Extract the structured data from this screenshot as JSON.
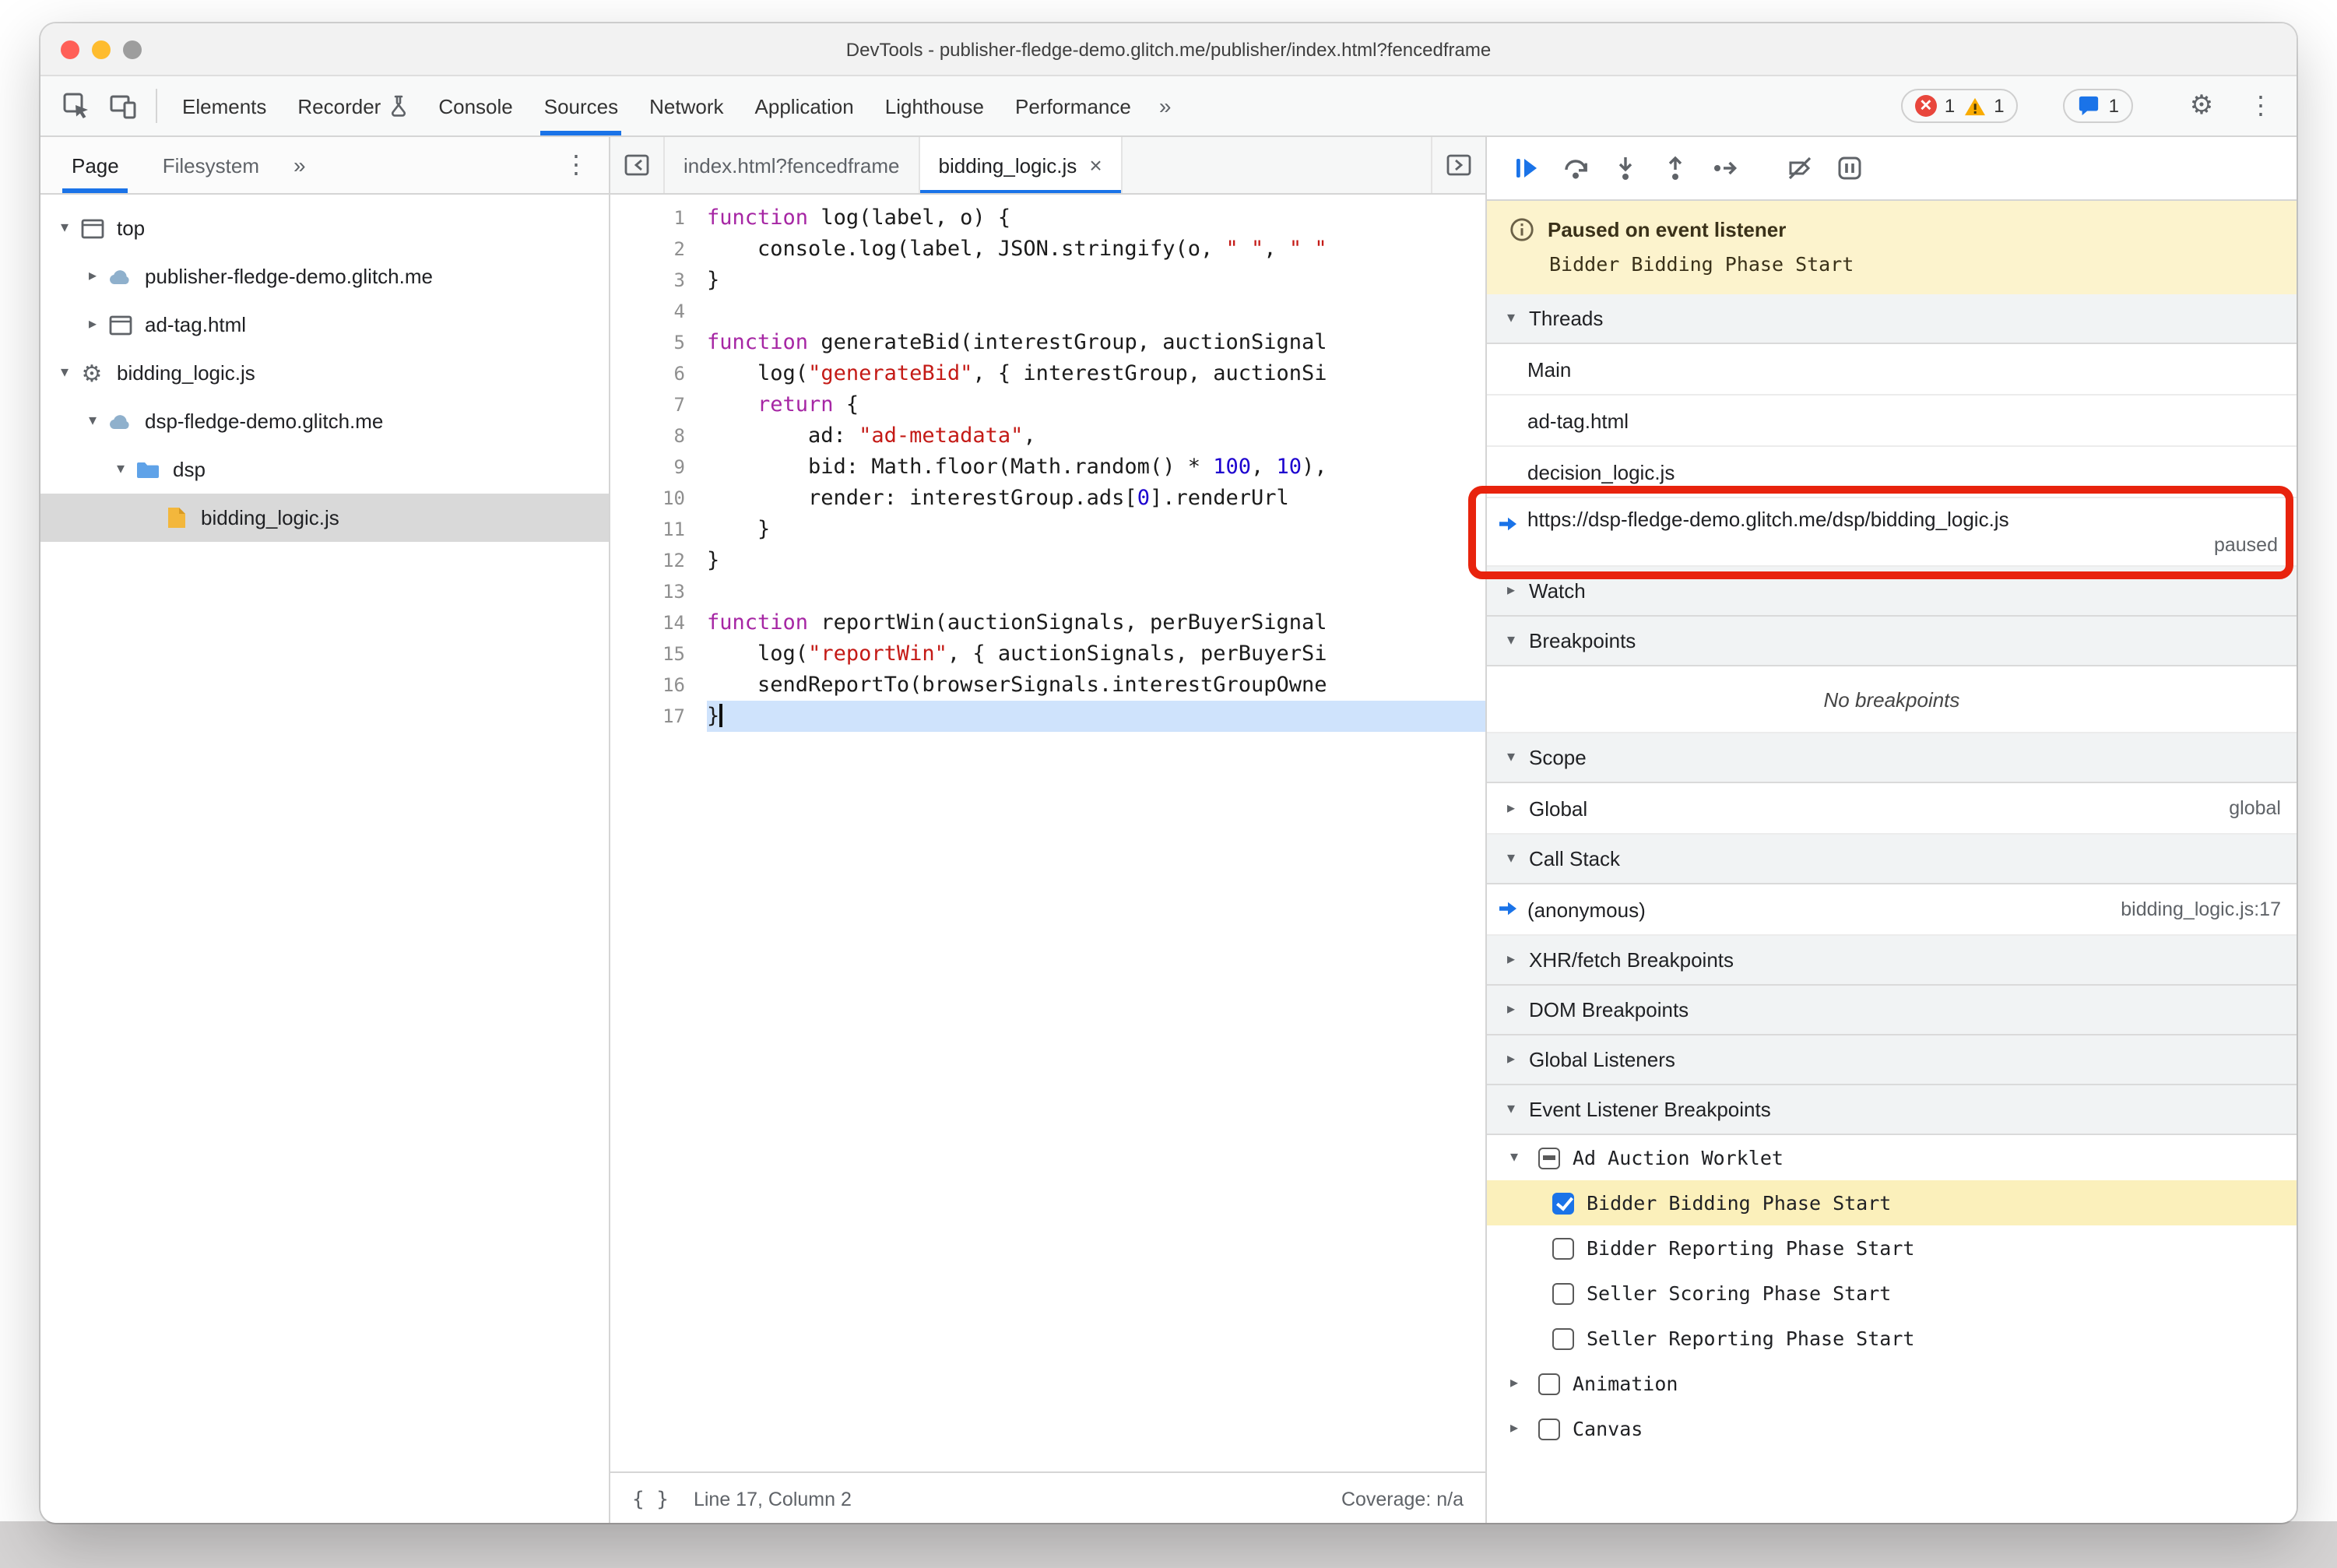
{
  "colors": {
    "accent": "#1a73e8",
    "annotation_red": "#e8230d",
    "banner_yellow": "#fcf3cd",
    "highlight_yellow": "#fbf0bb",
    "keyword": "#a626a4",
    "string": "#c41a16",
    "number": "#1c00cf"
  },
  "window": {
    "title": "DevTools - publisher-fledge-demo.glitch.me/publisher/index.html?fencedframe"
  },
  "main_toolbar": {
    "tabs": [
      {
        "label": "Elements"
      },
      {
        "label": "Recorder"
      },
      {
        "label": "Console"
      },
      {
        "label": "Sources"
      },
      {
        "label": "Network"
      },
      {
        "label": "Application"
      },
      {
        "label": "Lighthouse"
      },
      {
        "label": "Performance"
      }
    ],
    "more_label": "»",
    "errors": "1",
    "warnings": "1",
    "issues": "1"
  },
  "navigator": {
    "tabs": [
      {
        "label": "Page"
      },
      {
        "label": "Filesystem"
      }
    ],
    "more_label": "»",
    "tree": [
      {
        "label": "top"
      },
      {
        "label": "publisher-fledge-demo.glitch.me"
      },
      {
        "label": "ad-tag.html"
      },
      {
        "label": "bidding_logic.js"
      },
      {
        "label": "dsp-fledge-demo.glitch.me"
      },
      {
        "label": "dsp"
      },
      {
        "label": "bidding_logic.js"
      }
    ]
  },
  "editor": {
    "tabs": [
      {
        "label": "index.html?fencedframe"
      },
      {
        "label": "bidding_logic.js"
      }
    ],
    "close_label": "×",
    "current_line": 17,
    "code_lines": [
      [
        [
          "kw",
          "function"
        ],
        [
          "pl",
          " log(label, o) {"
        ]
      ],
      [
        [
          "pl",
          "    console.log(label, JSON.stringify(o, "
        ],
        [
          "str",
          "\" \""
        ],
        [
          "pl",
          ", "
        ],
        [
          "str",
          "\" \""
        ]
      ],
      [
        [
          "pl",
          "}"
        ]
      ],
      [],
      [
        [
          "kw",
          "function"
        ],
        [
          "pl",
          " generateBid(interestGroup, auctionSignal"
        ]
      ],
      [
        [
          "pl",
          "    log("
        ],
        [
          "str",
          "\"generateBid\""
        ],
        [
          "pl",
          ", { interestGroup, auctionSi"
        ]
      ],
      [
        [
          "pl",
          "    "
        ],
        [
          "kw",
          "return"
        ],
        [
          "pl",
          " {"
        ]
      ],
      [
        [
          "pl",
          "        ad: "
        ],
        [
          "str",
          "\"ad-metadata\""
        ],
        [
          "pl",
          ","
        ]
      ],
      [
        [
          "pl",
          "        bid: Math.floor(Math.random() * "
        ],
        [
          "num",
          "100"
        ],
        [
          "pl",
          ", "
        ],
        [
          "num",
          "10"
        ],
        [
          "pl",
          "),"
        ]
      ],
      [
        [
          "pl",
          "        render: interestGroup.ads["
        ],
        [
          "num",
          "0"
        ],
        [
          "pl",
          "].renderUrl"
        ]
      ],
      [
        [
          "pl",
          "    }"
        ]
      ],
      [
        [
          "pl",
          "}"
        ]
      ],
      [],
      [
        [
          "kw",
          "function"
        ],
        [
          "pl",
          " reportWin(auctionSignals, perBuyerSignal"
        ]
      ],
      [
        [
          "pl",
          "    log("
        ],
        [
          "str",
          "\"reportWin\""
        ],
        [
          "pl",
          ", { auctionSignals, perBuyerSi"
        ]
      ],
      [
        [
          "pl",
          "    sendReportTo(browserSignals.interestGroupOwne"
        ]
      ],
      [
        [
          "pl",
          "}"
        ]
      ]
    ],
    "status": {
      "pretty_print": "{ }",
      "position": "Line 17, Column 2",
      "coverage": "Coverage: n/a"
    }
  },
  "debugger": {
    "paused": {
      "title": "Paused on event listener",
      "detail": "Bidder Bidding Phase Start"
    },
    "threads": {
      "title": "Threads",
      "items": [
        {
          "label": "Main"
        },
        {
          "label": "ad-tag.html"
        },
        {
          "label": "decision_logic.js"
        }
      ],
      "active": {
        "url": "https://dsp-fledge-demo.glitch.me/dsp/bidding_logic.js",
        "status": "paused"
      }
    },
    "watch": {
      "title": "Watch"
    },
    "breakpoints": {
      "title": "Breakpoints",
      "empty": "No breakpoints"
    },
    "scope": {
      "title": "Scope",
      "rows": [
        {
          "label": "Global",
          "value": "global"
        }
      ]
    },
    "call_stack": {
      "title": "Call Stack",
      "frames": [
        {
          "label": "(anonymous)",
          "location": "bidding_logic.js:17"
        }
      ]
    },
    "xhr_breakpoints": {
      "title": "XHR/fetch Breakpoints"
    },
    "dom_breakpoints": {
      "title": "DOM Breakpoints"
    },
    "global_listeners": {
      "title": "Global Listeners"
    },
    "event_listener_breakpoints": {
      "title": "Event Listener Breakpoints",
      "group": {
        "label": "Ad Auction Worklet"
      },
      "events": [
        {
          "label": "Bidder Bidding Phase Start",
          "checked": true
        },
        {
          "label": "Bidder Reporting Phase Start",
          "checked": false
        },
        {
          "label": "Seller Scoring Phase Start",
          "checked": false
        },
        {
          "label": "Seller Reporting Phase Start",
          "checked": false
        }
      ],
      "categories": [
        {
          "label": "Animation"
        },
        {
          "label": "Canvas"
        }
      ]
    }
  }
}
